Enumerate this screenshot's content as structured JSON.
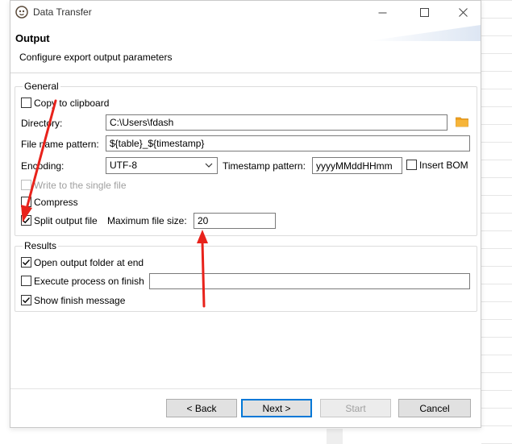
{
  "window": {
    "title": "Data Transfer",
    "controls": [
      "minimize",
      "maximize",
      "close"
    ]
  },
  "header": {
    "title": "Output",
    "description": "Configure export output parameters"
  },
  "general": {
    "label": "General",
    "copy_to_clipboard": {
      "label": "Copy to clipboard",
      "checked": false
    },
    "directory": {
      "label": "Directory:",
      "value": "C:\\Users\\fdash"
    },
    "file_name_pattern": {
      "label": "File name pattern:",
      "value": "${table}_${timestamp}"
    },
    "encoding": {
      "label": "Encoding:",
      "value": "UTF-8"
    },
    "timestamp_pattern": {
      "label": "Timestamp pattern:",
      "value": "yyyyMMddHHmm"
    },
    "insert_bom": {
      "label": "Insert BOM",
      "checked": false
    },
    "write_single_file": {
      "label": "Write to the single file",
      "checked": false,
      "enabled": false
    },
    "compress": {
      "label": "Compress",
      "checked": false
    },
    "split_output_file": {
      "label": "Split output file",
      "checked": true
    },
    "maximum_file_size": {
      "label": "Maximum file size:",
      "value": "20"
    }
  },
  "results": {
    "label": "Results",
    "open_output_folder": {
      "label": "Open output folder at end",
      "checked": true
    },
    "execute_process": {
      "label": "Execute process on finish",
      "checked": false,
      "value": ""
    },
    "show_finish_message": {
      "label": "Show finish message",
      "checked": true
    }
  },
  "footer": {
    "back": "< Back",
    "next": "Next >",
    "start": "Start",
    "cancel": "Cancel"
  },
  "colors": {
    "folder_icon": "#f0a020",
    "annotation_arrow": "#e8221b",
    "primary_border": "#0078d7"
  },
  "icons": {
    "app": "dbeaver-icon",
    "browse": "folder-icon"
  }
}
